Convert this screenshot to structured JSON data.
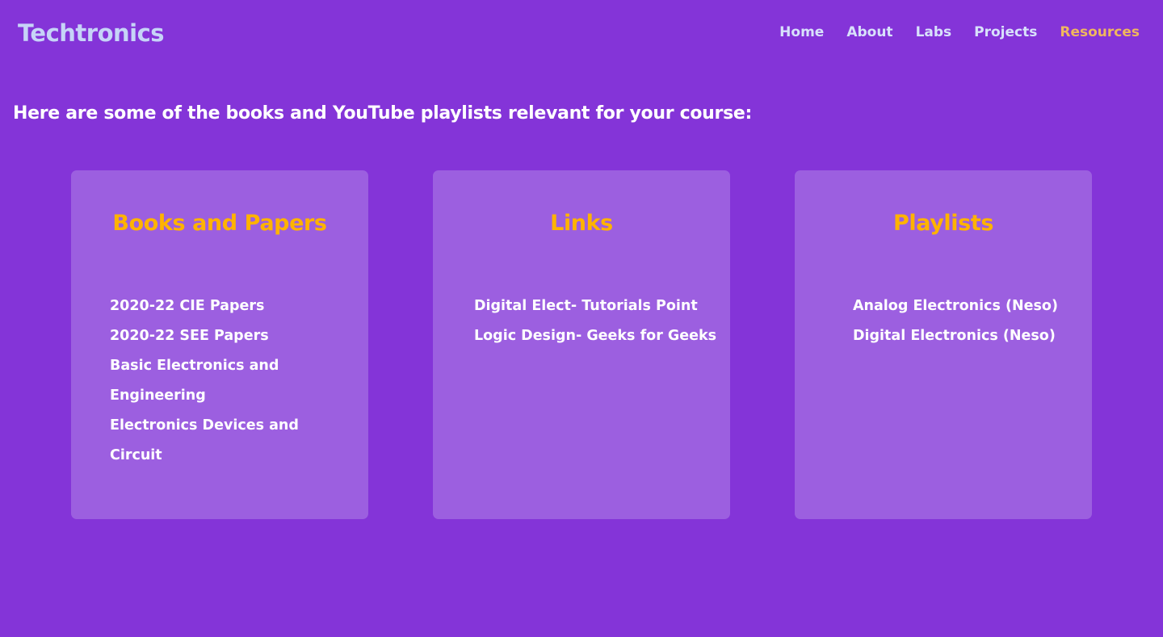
{
  "brand": "Techtronics",
  "nav": {
    "home": "Home",
    "about": "About",
    "labs": "Labs",
    "projects": "Projects",
    "resources": "Resources",
    "active_color": "#f0b75e"
  },
  "intro": "Here are some of the books and YouTube playlists relevant for your course:",
  "cards": {
    "books": {
      "title": "Books and Papers",
      "items": [
        "2020-22 CIE Papers",
        "2020-22 SEE Papers",
        "Basic Electronics and Engineering",
        "Electronics Devices and Circuit"
      ]
    },
    "links": {
      "title": "Links",
      "items": [
        "Digital Elect- Tutorials Point",
        "Logic Design- Geeks for Geeks"
      ]
    },
    "playlists": {
      "title": "Playlists",
      "items": [
        "Analog Electronics (Neso)",
        "Digital Electronics (Neso)"
      ]
    }
  },
  "colors": {
    "background": "#8434d8",
    "card": "#9c5fe0",
    "card_title": "#ffb300",
    "brand": "#c6d4f7"
  }
}
